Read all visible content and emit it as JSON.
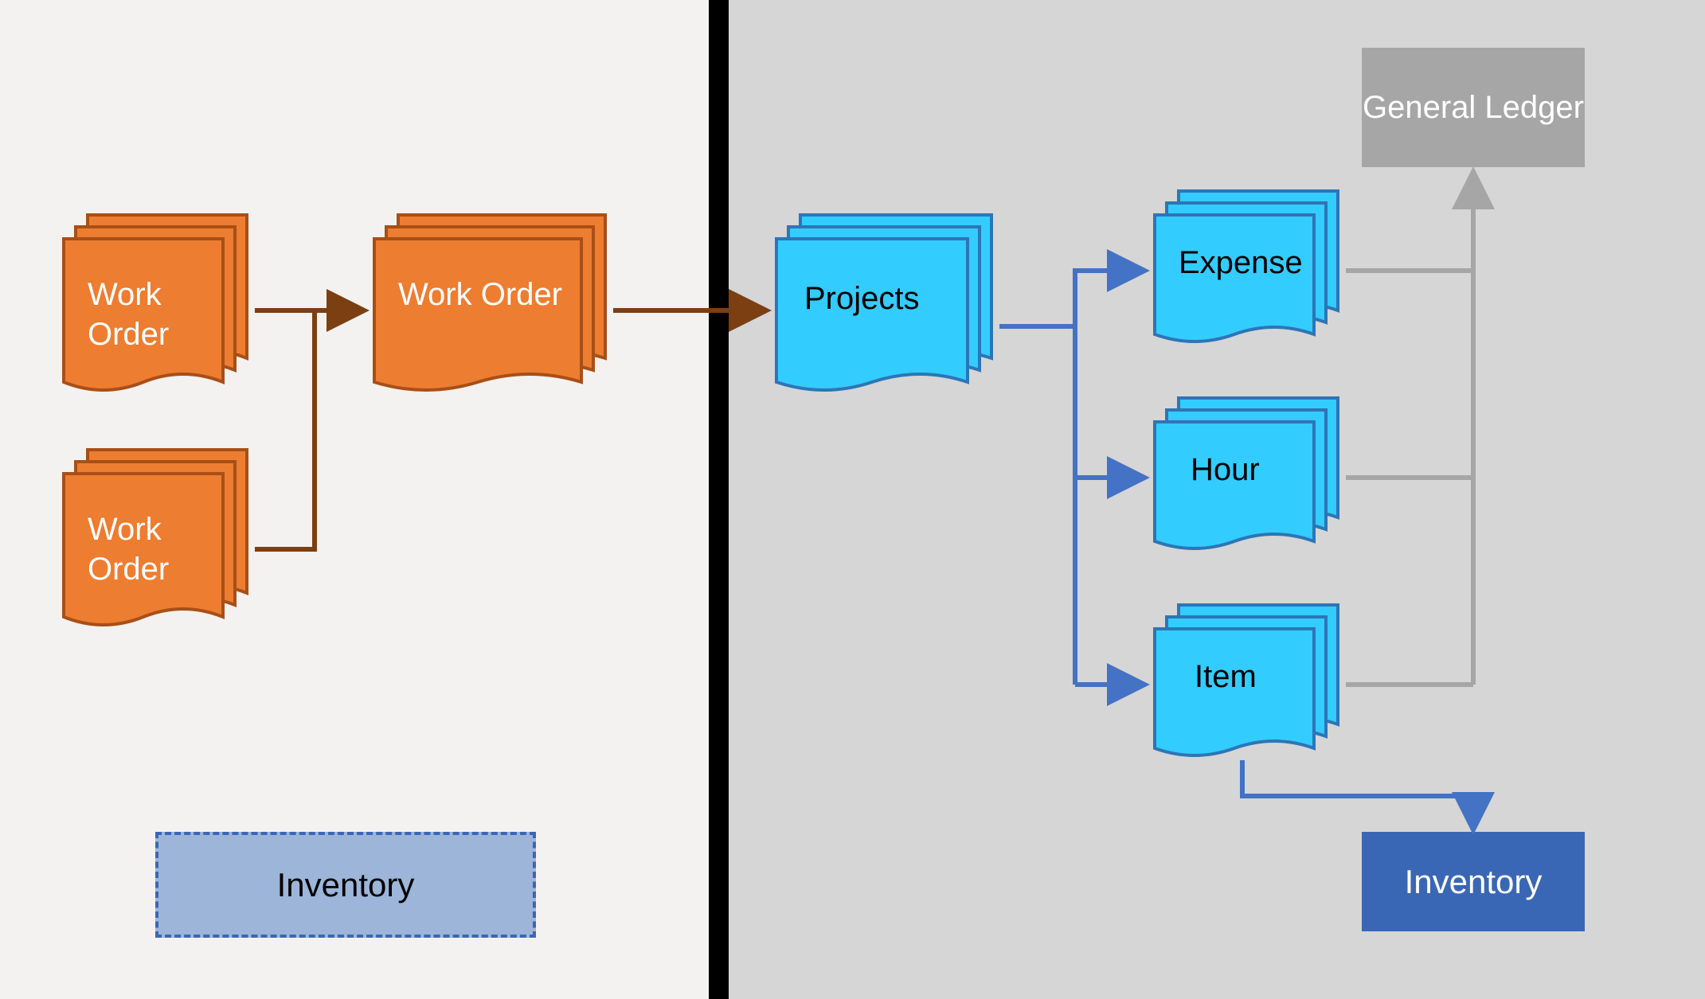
{
  "nodes": {
    "work_order_top": "Work\nOrder",
    "work_order_bottom": "Work\nOrder",
    "work_order_main": "Work Order",
    "projects": "Projects",
    "expense": "Expense",
    "hour": "Hour",
    "item": "Item",
    "general_ledger": "General\nLedger",
    "inventory_left": "Inventory",
    "inventory_right": "Inventory"
  },
  "colors": {
    "orange_fill": "#ed7d31",
    "orange_stroke": "#a84f17",
    "cyan_fill": "#33ccff",
    "cyan_stroke": "#2e75b6",
    "blue_arrow": "#4472c4",
    "grey_arrow": "#a6a6a6",
    "brown_arrow": "#7b3f12",
    "gl_fill": "#a6a6a6",
    "inv_solid": "#3a67b5",
    "inv_dashed_fill": "#9db5d9",
    "inv_dashed_border": "#3a67b5",
    "panel_left": "#f3f2f0",
    "panel_right": "#d6d6d6",
    "divider": "#000000"
  },
  "edges": [
    {
      "from": "work_order_top",
      "to": "work_order_main",
      "color": "brown"
    },
    {
      "from": "work_order_bottom",
      "to": "work_order_main",
      "color": "brown"
    },
    {
      "from": "work_order_main",
      "to": "projects",
      "color": "brown"
    },
    {
      "from": "projects",
      "to": "expense",
      "color": "blue"
    },
    {
      "from": "projects",
      "to": "hour",
      "color": "blue"
    },
    {
      "from": "projects",
      "to": "item",
      "color": "blue"
    },
    {
      "from": "expense",
      "to": "general_ledger",
      "color": "grey"
    },
    {
      "from": "hour",
      "to": "general_ledger",
      "color": "grey"
    },
    {
      "from": "item",
      "to": "general_ledger",
      "color": "grey"
    },
    {
      "from": "item",
      "to": "inventory_right",
      "color": "blue"
    }
  ]
}
